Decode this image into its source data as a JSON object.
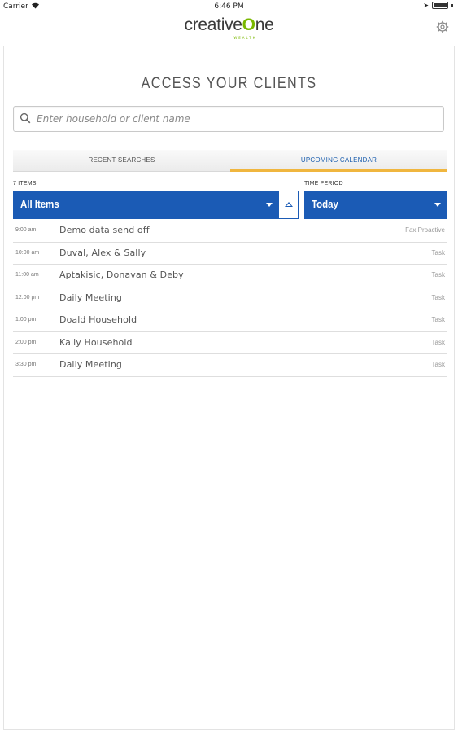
{
  "statusbar": {
    "carrier": "Carrier",
    "wifi_icon": "wifi-icon",
    "time": "6:46 PM",
    "battery_icon": "battery-icon"
  },
  "navbar": {
    "logo_prefix": "creative",
    "logo_o": "O",
    "logo_suffix": "ne",
    "logo_sub": "WEALTH",
    "settings_icon": "gear-icon"
  },
  "page": {
    "title": "ACCESS YOUR CLIENTS"
  },
  "search": {
    "placeholder": "Enter household or client name",
    "value": "",
    "icon": "search-icon"
  },
  "tabs": [
    {
      "label": "RECENT SEARCHES",
      "active": false
    },
    {
      "label": "UPCOMING CALENDAR",
      "active": true
    }
  ],
  "filters": {
    "items_count_label": "7 ITEMS",
    "items_selected": "All Items",
    "time_period_label": "TIME PERIOD",
    "time_period_selected": "Today"
  },
  "calendar": [
    {
      "time": "9:00 am",
      "name": "Demo data send off",
      "type": "Fax Proactive"
    },
    {
      "time": "10:00 am",
      "name": "Duval, Alex & Sally",
      "type": "Task"
    },
    {
      "time": "11:00 am",
      "name": "Aptakisic, Donavan & Deby",
      "type": "Task"
    },
    {
      "time": "12:00 pm",
      "name": "Daily Meeting",
      "type": "Task"
    },
    {
      "time": "1:00 pm",
      "name": "Doald Household",
      "type": "Task"
    },
    {
      "time": "2:00 pm",
      "name": "Kally Household",
      "type": "Task"
    },
    {
      "time": "3:30 pm",
      "name": "Daily Meeting",
      "type": "Task"
    }
  ],
  "colors": {
    "accent_blue": "#1b5bb5",
    "tab_underline": "#f0b63f",
    "brand_green": "#7ab800"
  }
}
